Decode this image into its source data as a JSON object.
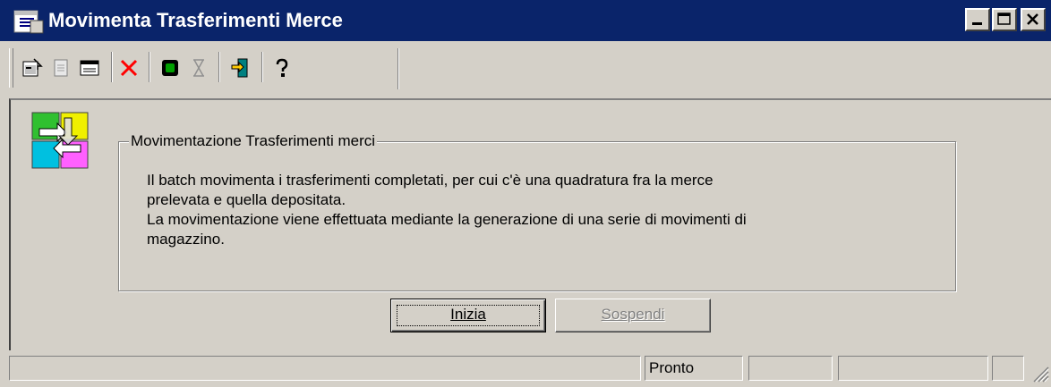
{
  "window": {
    "title": "Movimenta Trasferimenti Merce",
    "colors": {
      "titlebar": "#0a246a",
      "face": "#d4d0c8",
      "delete_red": "#ff0000"
    }
  },
  "titlebar_buttons": [
    {
      "name": "minimize",
      "icon": "minimize-icon"
    },
    {
      "name": "maximize",
      "icon": "maximize-icon"
    },
    {
      "name": "close",
      "icon": "close-icon"
    }
  ],
  "toolbar": {
    "buttons": [
      {
        "icon": "properties-icon",
        "enabled": true
      },
      {
        "icon": "document-icon",
        "enabled": false
      },
      {
        "icon": "window-icon",
        "enabled": true
      },
      {
        "icon": "delete-icon",
        "enabled": true
      },
      {
        "icon": "run-icon",
        "enabled": true
      },
      {
        "icon": "hourglass-icon",
        "enabled": false
      },
      {
        "icon": "exit-icon",
        "enabled": true
      },
      {
        "icon": "help-icon",
        "enabled": true
      }
    ]
  },
  "panel": {
    "group_title": "Movimentazione Trasferimenti merci",
    "description_lines": [
      "Il batch movimenta i trasferimenti completati, per cui c'è una quadratura fra la merce",
      "prelevata e quella depositata.",
      "La movimentazione viene effettuata mediante la generazione di una serie di movimenti di",
      "magazzino."
    ]
  },
  "buttons": {
    "start_label": "Inizia",
    "stop_label": "Sospendi"
  },
  "statusbar": {
    "status_text": "Pronto"
  }
}
